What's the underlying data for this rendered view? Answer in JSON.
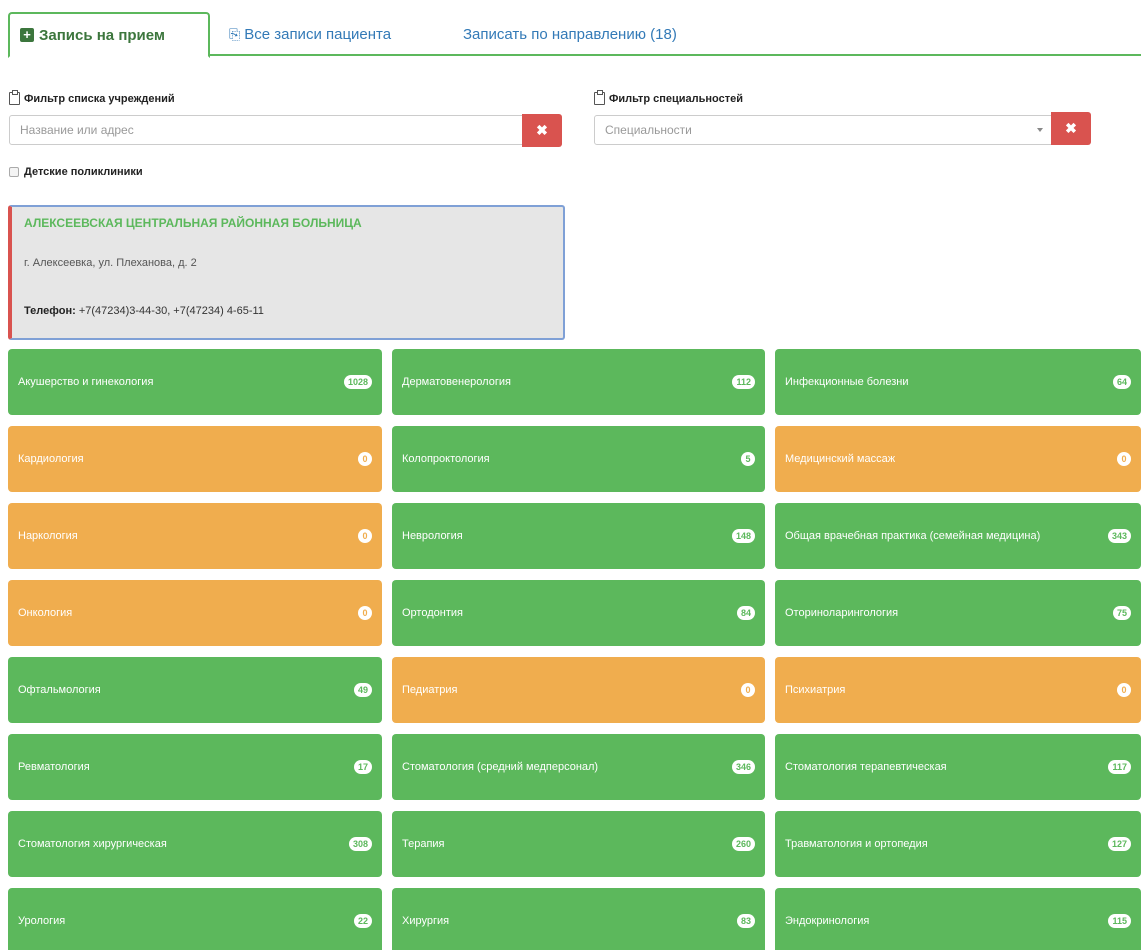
{
  "tabs": [
    {
      "label": "Запись на прием",
      "active": true
    },
    {
      "label": "Все записи пациента",
      "active": false
    },
    {
      "label": "Записать по направлению (18)",
      "active": false
    }
  ],
  "filters": {
    "institutions": {
      "label": "Фильтр списка учреждений",
      "placeholder": "Название или адрес",
      "clear_icon": "✖"
    },
    "specialties": {
      "label": "Фильтр специальностей",
      "placeholder": "Специальности",
      "clear_icon": "✖"
    },
    "children_checkbox": {
      "label": "Детские поликлиники",
      "checked": false
    }
  },
  "hospital": {
    "name": "АЛЕКСЕЕВСКАЯ ЦЕНТРАЛЬНАЯ РАЙОННАЯ БОЛЬНИЦА",
    "address": "г. Алексеевка, ул. Плеханова, д. 2",
    "phone_label": "Телефон:",
    "phone_value": " +7(47234)3-44-30, +7(47234) 4-65-11"
  },
  "specialties": [
    {
      "name": "Акушерство и гинекология",
      "count": "1028",
      "status": "green"
    },
    {
      "name": "Дерматовенерология",
      "count": "112",
      "status": "green"
    },
    {
      "name": "Инфекционные болезни",
      "count": "64",
      "status": "green"
    },
    {
      "name": "Кардиология",
      "count": "0",
      "status": "orange"
    },
    {
      "name": "Колопроктология",
      "count": "5",
      "status": "green"
    },
    {
      "name": "Медицинский массаж",
      "count": "0",
      "status": "orange"
    },
    {
      "name": "Наркология",
      "count": "0",
      "status": "orange"
    },
    {
      "name": "Неврология",
      "count": "148",
      "status": "green"
    },
    {
      "name": "Общая врачебная практика (семейная медицина)",
      "count": "343",
      "status": "green"
    },
    {
      "name": "Онкология",
      "count": "0",
      "status": "orange"
    },
    {
      "name": "Ортодонтия",
      "count": "84",
      "status": "green"
    },
    {
      "name": "Оториноларингология",
      "count": "75",
      "status": "green"
    },
    {
      "name": "Офтальмология",
      "count": "49",
      "status": "green"
    },
    {
      "name": "Педиатрия",
      "count": "0",
      "status": "orange"
    },
    {
      "name": "Психиатрия",
      "count": "0",
      "status": "orange"
    },
    {
      "name": "Ревматология",
      "count": "17",
      "status": "green"
    },
    {
      "name": "Стоматология (средний медперсонал)",
      "count": "346",
      "status": "green"
    },
    {
      "name": "Стоматология терапевтическая",
      "count": "117",
      "status": "green"
    },
    {
      "name": "Стоматология хирургическая",
      "count": "308",
      "status": "green"
    },
    {
      "name": "Терапия",
      "count": "260",
      "status": "green"
    },
    {
      "name": "Травматология и ортопедия",
      "count": "127",
      "status": "green"
    },
    {
      "name": "Урология",
      "count": "22",
      "status": "green"
    },
    {
      "name": "Хирургия",
      "count": "83",
      "status": "green"
    },
    {
      "name": "Эндокринология",
      "count": "115",
      "status": "green"
    }
  ],
  "colors": {
    "available": "#5cb85c",
    "unavailable": "#f0ad4e",
    "danger": "#d9534f",
    "link": "#337ab7"
  }
}
